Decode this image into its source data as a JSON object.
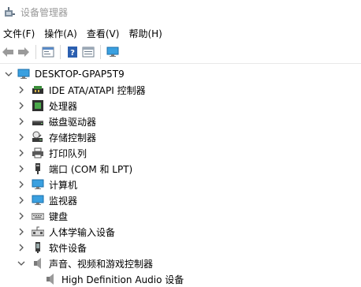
{
  "window": {
    "title": "设备管理器"
  },
  "menu": [
    "文件(F)",
    "操作(A)",
    "查看(V)",
    "帮助(H)"
  ],
  "toolbar": {
    "buttons": [
      "back-arrow-icon",
      "forward-arrow-icon",
      "properties-icon",
      "help-icon",
      "details-icon",
      "monitor-icon"
    ]
  },
  "tree": {
    "root": "DESKTOP-GPAP5T9",
    "items": [
      {
        "label": "IDE ATA/ATAPI 控制器",
        "icon": "ide-controller-icon",
        "state": "collapsed"
      },
      {
        "label": "处理器",
        "icon": "processor-icon",
        "state": "collapsed"
      },
      {
        "label": "磁盘驱动器",
        "icon": "disk-drive-icon",
        "state": "collapsed"
      },
      {
        "label": "存储控制器",
        "icon": "storage-controller-icon",
        "state": "collapsed"
      },
      {
        "label": "打印队列",
        "icon": "printer-icon",
        "state": "collapsed"
      },
      {
        "label": "端口 (COM 和 LPT)",
        "icon": "port-icon",
        "state": "collapsed"
      },
      {
        "label": "计算机",
        "icon": "computer-icon",
        "state": "collapsed"
      },
      {
        "label": "监视器",
        "icon": "monitor-icon",
        "state": "collapsed"
      },
      {
        "label": "键盘",
        "icon": "keyboard-icon",
        "state": "collapsed"
      },
      {
        "label": "人体学输入设备",
        "icon": "hid-icon",
        "state": "collapsed"
      },
      {
        "label": "软件设备",
        "icon": "software-device-icon",
        "state": "collapsed"
      },
      {
        "label": "声音、视频和游戏控制器",
        "icon": "speaker-icon",
        "state": "expanded"
      }
    ],
    "child": {
      "label": "High Definition Audio 设备",
      "icon": "speaker-icon"
    }
  }
}
